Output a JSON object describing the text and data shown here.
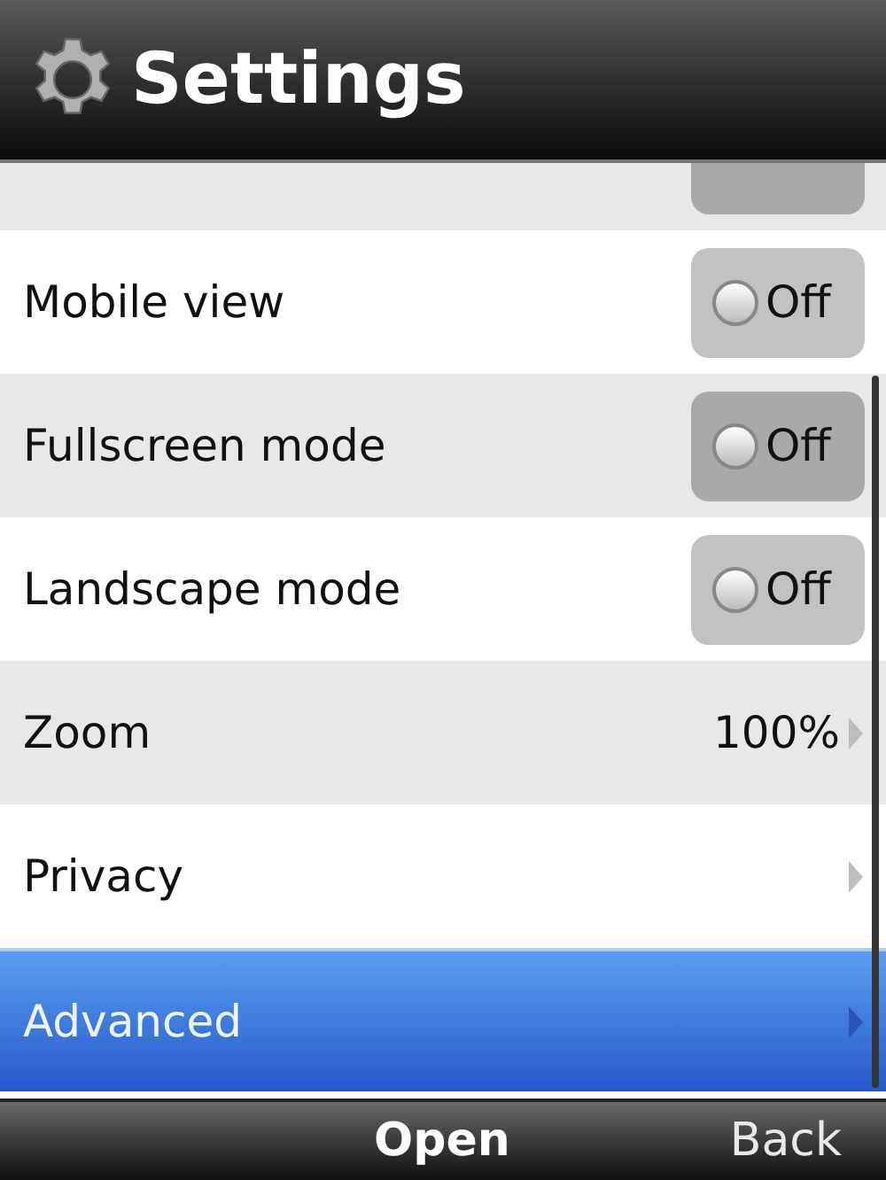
{
  "header": {
    "title": "Settings"
  },
  "items": [
    {
      "kind": "toggle",
      "selected": false
    },
    {
      "kind": "toggle",
      "label": "Mobile view",
      "value": "Off",
      "on": false,
      "selected": false
    },
    {
      "kind": "toggle",
      "label": "Fullscreen mode",
      "value": "Off",
      "on": false,
      "selected": false
    },
    {
      "kind": "toggle",
      "label": "Landscape mode",
      "value": "Off",
      "on": false,
      "selected": false
    },
    {
      "kind": "value",
      "label": "Zoom",
      "value": "100%",
      "selected": false
    },
    {
      "kind": "link",
      "label": "Privacy",
      "selected": false
    },
    {
      "kind": "link",
      "label": "Advanced",
      "selected": true
    }
  ],
  "softkeys": {
    "center": "Open",
    "right": "Back"
  }
}
